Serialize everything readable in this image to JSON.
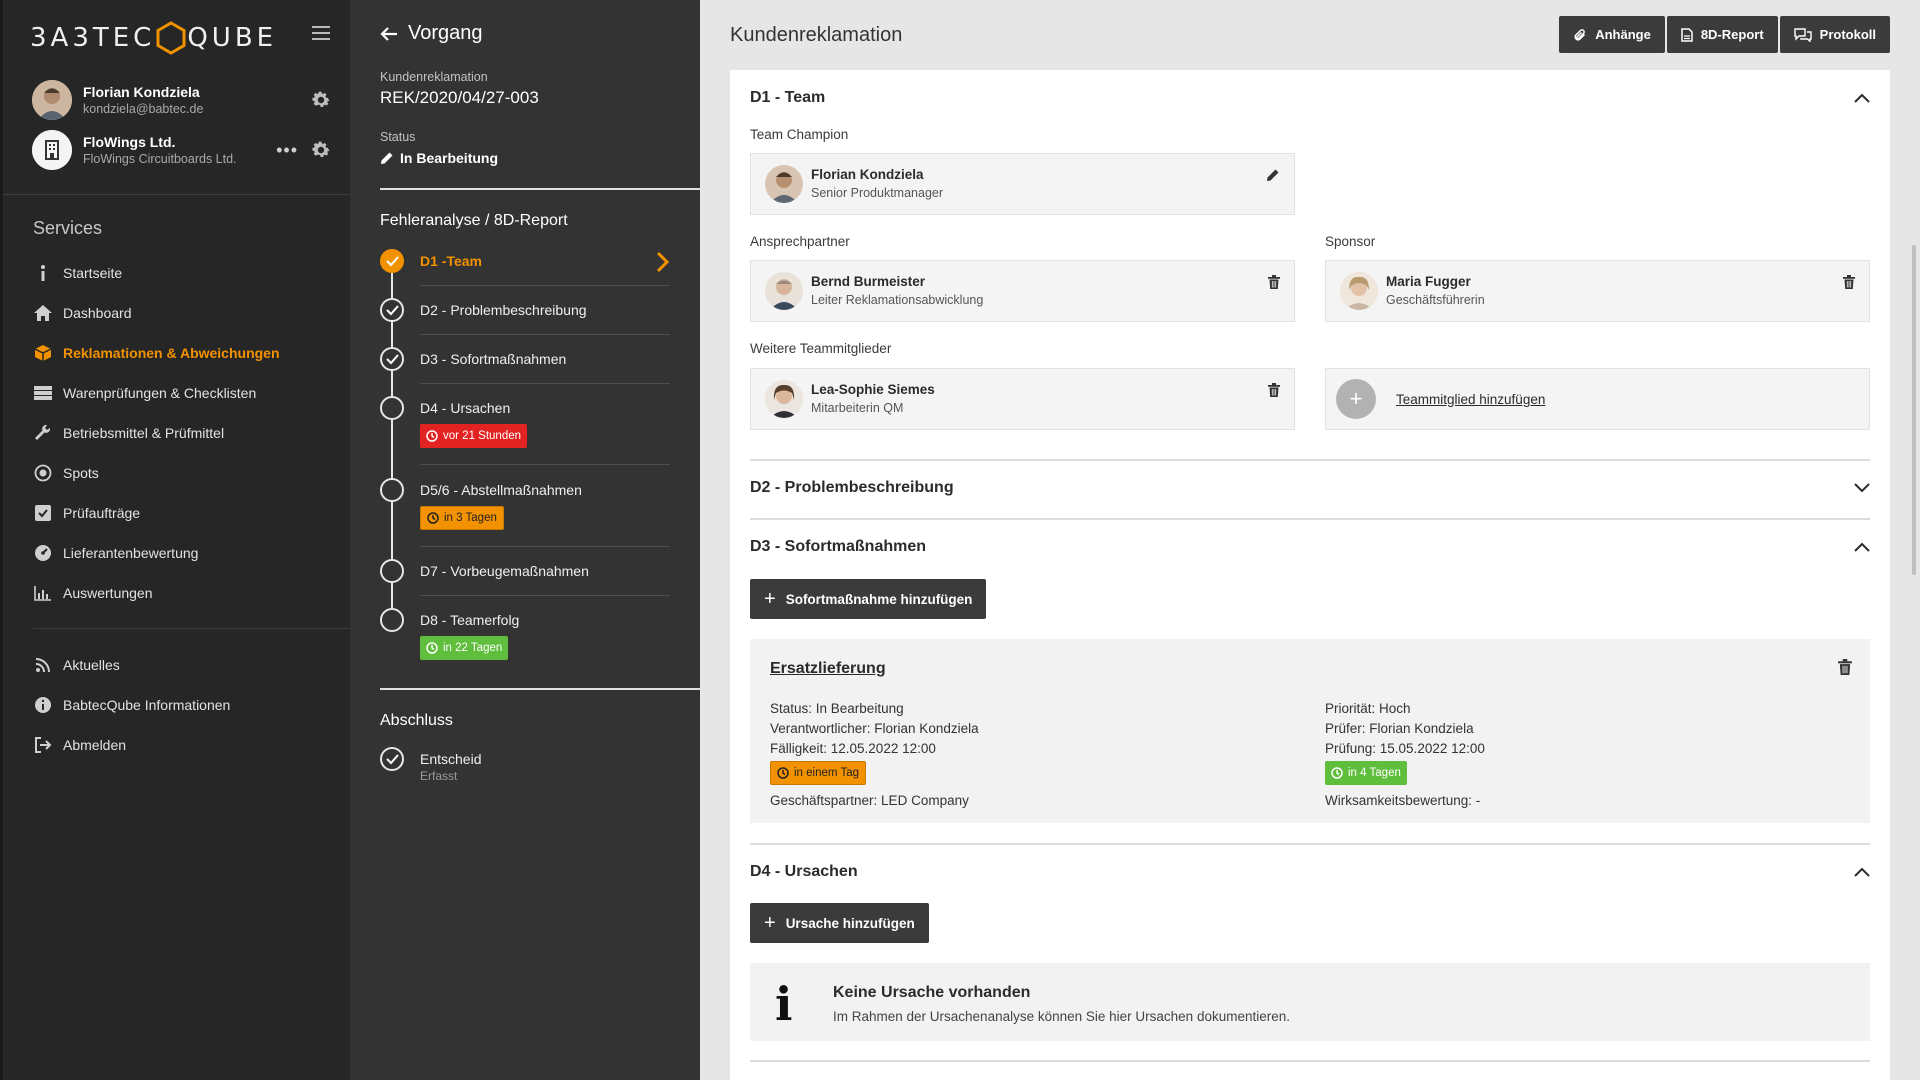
{
  "app": {
    "logo_left": "3A3TEC",
    "logo_right": "QUBE"
  },
  "user": {
    "name": "Florian Kondziela",
    "email": "kondziela@babtec.de"
  },
  "company": {
    "name": "FloWings Ltd.",
    "subtitle": "FloWings Circuitboards Ltd.",
    "more": "•••"
  },
  "sidebar": {
    "heading": "Services",
    "items": [
      {
        "label": "Startseite",
        "icon": "info-icon"
      },
      {
        "label": "Dashboard",
        "icon": "home-icon"
      },
      {
        "label": "Reklamationen & Abweichungen",
        "icon": "box-icon",
        "active": true
      },
      {
        "label": "Warenprüfungen & Checklisten",
        "icon": "list-icon"
      },
      {
        "label": "Betriebsmittel & Prüfmittel",
        "icon": "wrench-icon"
      },
      {
        "label": "Spots",
        "icon": "spot-icon"
      },
      {
        "label": "Prüfaufträge",
        "icon": "checkbox-icon"
      },
      {
        "label": "Lieferantenbewertung",
        "icon": "gauge-icon"
      },
      {
        "label": "Auswertungen",
        "icon": "chart-icon"
      }
    ],
    "bottom_items": [
      {
        "label": "Aktuelles",
        "icon": "rss-icon"
      },
      {
        "label": "BabtecQube Informationen",
        "icon": "info-circle-icon"
      },
      {
        "label": "Abmelden",
        "icon": "logout-icon"
      }
    ]
  },
  "process": {
    "back_label": "Vorgang",
    "type_label": "Kundenreklamation",
    "number": "REK/2020/04/27-003",
    "status_label": "Status",
    "status_value": "In Bearbeitung",
    "section_title": "Fehleranalyse / 8D-Report",
    "steps": [
      {
        "title": "D1 -Team",
        "state": "current"
      },
      {
        "title": "D2 - Problembeschreibung",
        "state": "done"
      },
      {
        "title": "D3 - Sofortmaßnahmen",
        "state": "done"
      },
      {
        "title": "D4 - Ursachen",
        "state": "open",
        "badge": "vor 21 Stunden",
        "badge_color": "red"
      },
      {
        "title": "D5/6 - Abstellmaßnahmen",
        "state": "open",
        "badge": "in 3 Tagen",
        "badge_color": "orange"
      },
      {
        "title": "D7 - Vorbeugemaßnahmen",
        "state": "open"
      },
      {
        "title": "D8 - Teamerfolg",
        "state": "open",
        "badge": "in 22 Tagen",
        "badge_color": "green"
      }
    ],
    "closing_title": "Abschluss",
    "closing_step": {
      "title": "Entscheid",
      "sub": "Erfasst"
    }
  },
  "main": {
    "title": "Kundenreklamation",
    "buttons": {
      "attachments": "Anhänge",
      "report": "8D-Report",
      "protocol": "Protokoll"
    },
    "d1": {
      "title": "D1 - Team",
      "champion_label": "Team Champion",
      "champion": {
        "name": "Florian Kondziela",
        "role": "Senior Produktmanager"
      },
      "contact_label": "Ansprechpartner",
      "contact": {
        "name": "Bernd Burmeister",
        "role": "Leiter Reklamationsabwicklung"
      },
      "sponsor_label": "Sponsor",
      "sponsor": {
        "name": "Maria Fugger",
        "role": "Geschäftsführerin"
      },
      "members_label": "Weitere Teammitglieder",
      "member": {
        "name": "Lea-Sophie Siemes",
        "role": "Mitarbeiterin QM"
      },
      "add_member": "Teammitglied hinzufügen"
    },
    "d2": {
      "title": "D2 - Problembeschreibung"
    },
    "d3": {
      "title": "D3 - Sofortmaßnahmen",
      "add_button": "Sofortmaßnahme hinzufügen",
      "measure": {
        "title": "Ersatzlieferung",
        "status": "Status:  In Bearbeitung",
        "responsible": "Verantwortlicher:  Florian Kondziela",
        "due": "Fälligkeit:  12.05.2022 12:00",
        "due_badge": "in einem Tag",
        "partner": "Geschäftspartner:  LED Company",
        "priority": "Priorität:  Hoch",
        "checker": "Prüfer:  Florian Kondziela",
        "check_date": "Prüfung:  15.05.2022 12:00",
        "check_badge": "in 4 Tagen",
        "effectiveness": "Wirksamkeitsbewertung:  -"
      }
    },
    "d4": {
      "title": "D4 - Ursachen",
      "add_button": "Ursache hinzufügen",
      "empty_title": "Keine Ursache vorhanden",
      "empty_text": "Im Rahmen der Ursachenanalyse können Sie hier Ursachen dokumentieren."
    }
  },
  "colors": {
    "accent": "#f39200",
    "sidebar_bg": "#262626",
    "panel_bg": "#333333",
    "red": "#e32222",
    "green": "#5fbf3c"
  }
}
